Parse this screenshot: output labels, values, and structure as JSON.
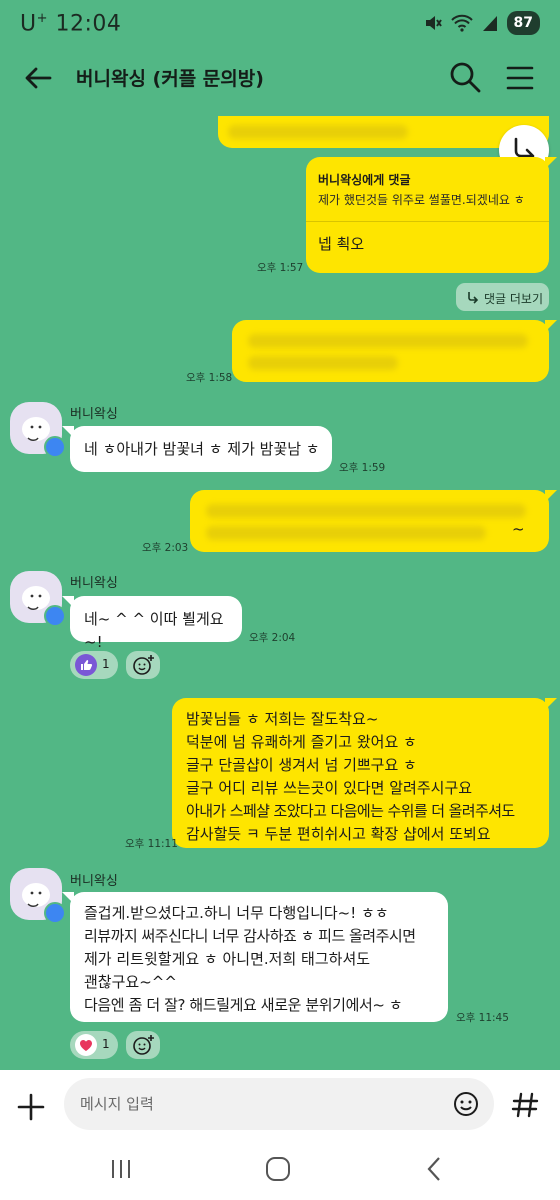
{
  "status_bar": {
    "carrier": "U",
    "carrier_sup": "+",
    "time": "12:04",
    "battery": "87"
  },
  "header": {
    "title": "버니왁싱 (커플 문의방)"
  },
  "messages": {
    "m1": {
      "reply_to": "버니왁싱에게 댓글",
      "quoted": "제가 했던것들 위주로 썰풀면.되겠네요 ㅎ",
      "text": "넵 쵝오",
      "time": "오후 1:57"
    },
    "more_replies": "댓글 더보기",
    "m2": {
      "time": "오후 1:58"
    },
    "m3": {
      "sender": "버니왁싱",
      "text": "네 ㅎ아내가 밤꽃녀 ㅎ 제가 밤꽃남 ㅎ",
      "time": "오후 1:59"
    },
    "m4": {
      "time": "오후 2:03",
      "visible_fragment": "~"
    },
    "m5": {
      "sender": "버니왁싱",
      "text": "네~ ^ ^ 이따 뵐게요~!",
      "time": "오후 2:04",
      "like_count": "1"
    },
    "m6": {
      "lines": [
        "밤꽃님들 ㅎ 저희는 잘도착요~",
        "덕분에 넘 유쾌하게 즐기고 왔어요 ㅎ",
        "글구 단골샵이 생겨서 넘 기쁘구요 ㅎ",
        "글구 어디 리뷰 쓰는곳이 있다면 알려주시구요",
        "아내가 스페샬 조았다고 다음에는 수위를 더 올려주셔도",
        "감사할듯 ㅋ 두분 편히쉬시고 확장 샵에서 또뵈요"
      ],
      "time": "오후 11:11"
    },
    "m7": {
      "sender": "버니왁싱",
      "lines": [
        "즐겁게.받으셨다고.하니 너무 다행입니다~! ㅎㅎ",
        "리뷰까지 써주신다니 너무 감사하죠 ㅎ 피드 올려주시면",
        "제가 리트윗할게요 ㅎ 아니면.저희 태그하셔도",
        "괜찮구요~^^",
        "다음엔 좀 더 잘? 해드릴게요 새로운 분위기에서~ ㅎ"
      ],
      "time": "오후 11:45",
      "heart_count": "1"
    }
  },
  "input": {
    "placeholder": "메시지 입력"
  },
  "icons": {
    "back": "arrow-left-icon",
    "search": "search-icon",
    "menu": "hamburger-menu-icon",
    "reply_share": "reply-arrow-icon",
    "plus": "plus-icon",
    "emoji": "emoji-icon",
    "hash": "hash-icon",
    "like": "thumbs-up-icon",
    "heart": "heart-icon",
    "add_reaction": "add-reaction-icon"
  },
  "colors": {
    "background": "#52b785",
    "my_bubble": "#fee500",
    "their_bubble": "#ffffff",
    "badge": "#3d86f2"
  }
}
